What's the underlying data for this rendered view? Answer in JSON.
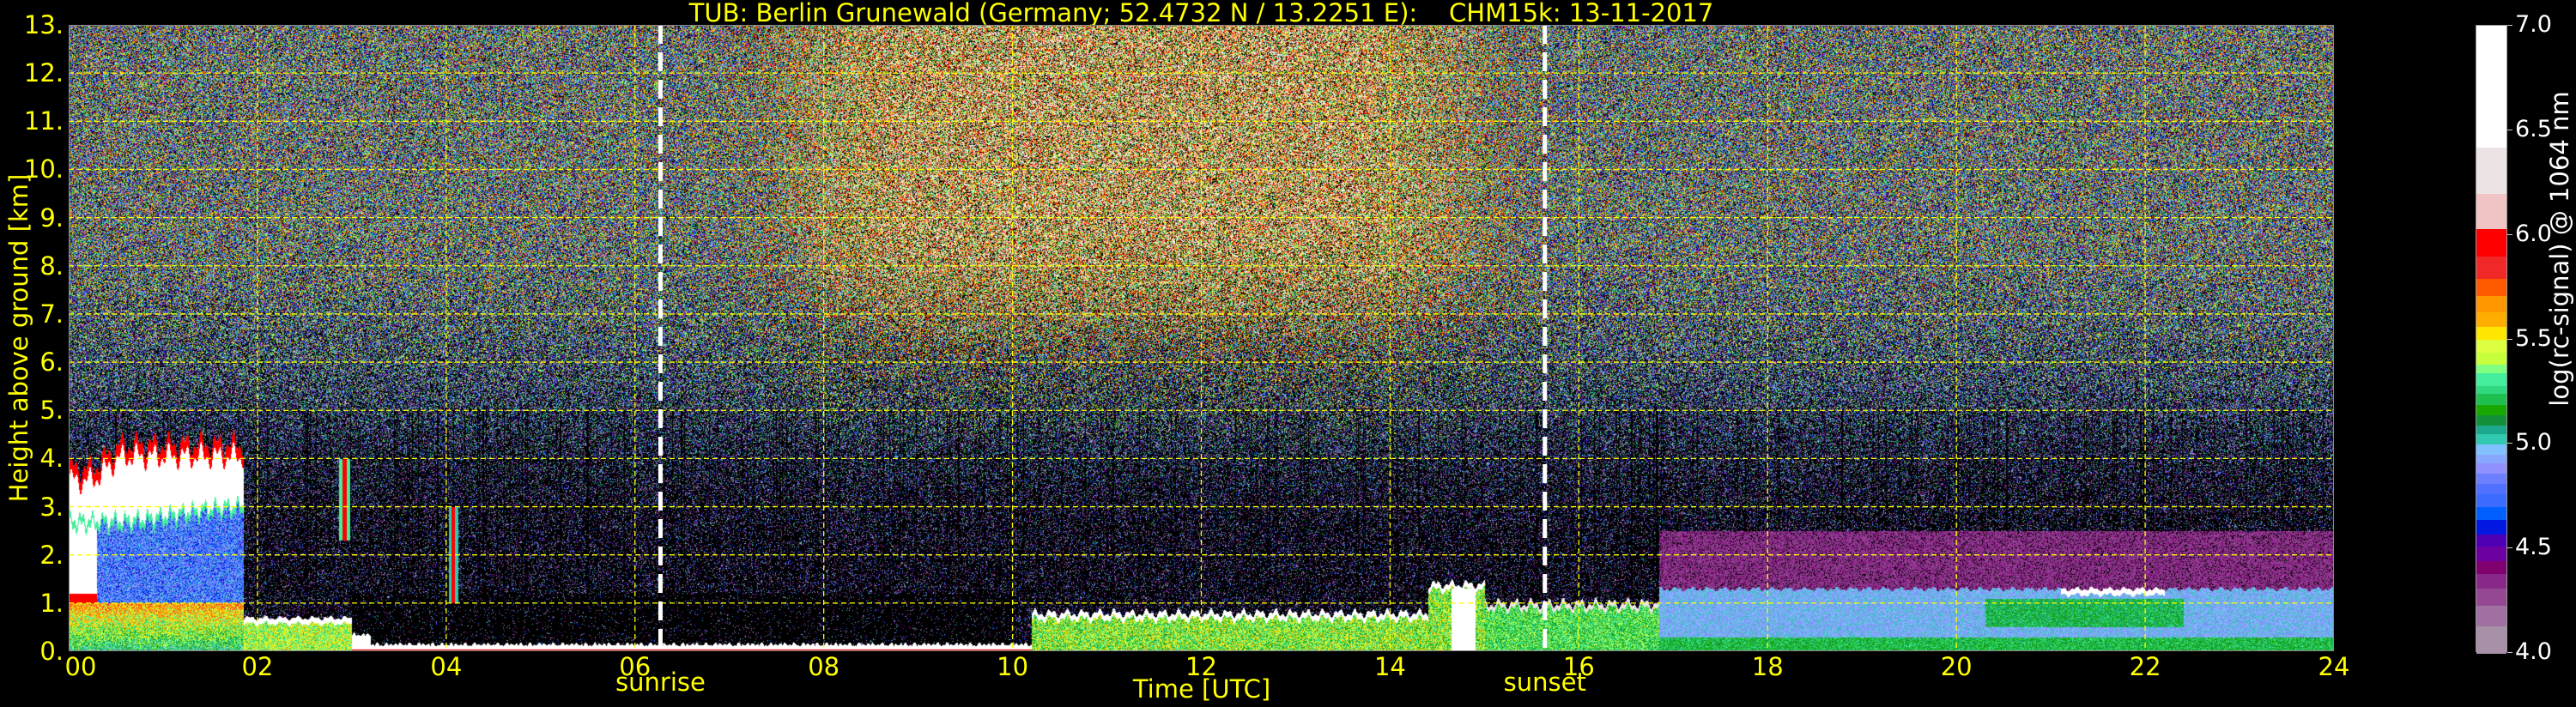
{
  "chart_data": {
    "type": "heatmap",
    "title": "TUB: Berlin Grunewald (Germany; 52.4732 N / 13.2251 E):    CHM15k: 13-11-2017",
    "xlabel": "Time [UTC]",
    "ylabel": "Height above ground [km]",
    "xlim": [
      0,
      24
    ],
    "ylim": [
      0,
      13
    ],
    "xticks": [
      0,
      2,
      4,
      6,
      8,
      10,
      12,
      14,
      16,
      18,
      20,
      22,
      24
    ],
    "xtick_labels": [
      "00",
      "02",
      "04",
      "06",
      "08",
      "10",
      "12",
      "14",
      "16",
      "18",
      "20",
      "22",
      "24"
    ],
    "yticks": [
      0,
      1,
      2,
      3,
      4,
      5,
      6,
      7,
      8,
      9,
      10,
      11,
      12,
      13
    ],
    "ytick_labels": [
      "0.",
      "1.",
      "2.",
      "3.",
      "4.",
      "5.",
      "6.",
      "7.",
      "8.",
      "9.",
      "10.",
      "11.",
      "12.",
      "13."
    ],
    "grid": true,
    "grid_color": "#ffff00",
    "annotations": [
      {
        "label": "sunrise",
        "time": 6.27,
        "line_color": "#ffffff"
      },
      {
        "label": "sunset",
        "time": 15.64,
        "line_color": "#ffffff"
      }
    ],
    "colorbar": {
      "label": "log(rc-signal) @ 1064 nm",
      "range": [
        4.0,
        7.0
      ],
      "ticks": [
        4.0,
        4.5,
        5.0,
        5.5,
        6.0,
        6.5,
        7.0
      ],
      "tick_labels": [
        "4.0",
        "4.5",
        "5.0",
        "5.5",
        "6.0",
        "6.5",
        "7.0"
      ],
      "boundaries": [
        4.0,
        4.13,
        4.23,
        4.31,
        4.38,
        4.44,
        4.51,
        4.57,
        4.64,
        4.7,
        4.76,
        4.81,
        4.86,
        4.91,
        4.95,
        5.0,
        5.05,
        5.09,
        5.14,
        5.19,
        5.24,
        5.28,
        5.34,
        5.38,
        5.44,
        5.5,
        5.56,
        5.63,
        5.71,
        5.79,
        5.9,
        6.03,
        6.2,
        6.42,
        7.0
      ],
      "colors": [
        "#a890a8",
        "#a070a0",
        "#944894",
        "#882888",
        "#800070",
        "#6c00a0",
        "#5000b4",
        "#0018e0",
        "#0060ff",
        "#3c6cff",
        "#5070ff",
        "#6c80ff",
        "#9090ff",
        "#88a8ff",
        "#80c0ff",
        "#30c8b0",
        "#1ca88c",
        "#14903a",
        "#18a800",
        "#20c050",
        "#30d880",
        "#44ee9c",
        "#80ff80",
        "#c8ff3c",
        "#dcff40",
        "#ffe600",
        "#ffae00",
        "#ff9800",
        "#ff5a00",
        "#f02828",
        "#ff0000",
        "#f0c4c4",
        "#ece4e4",
        "#ffffff"
      ]
    }
  }
}
